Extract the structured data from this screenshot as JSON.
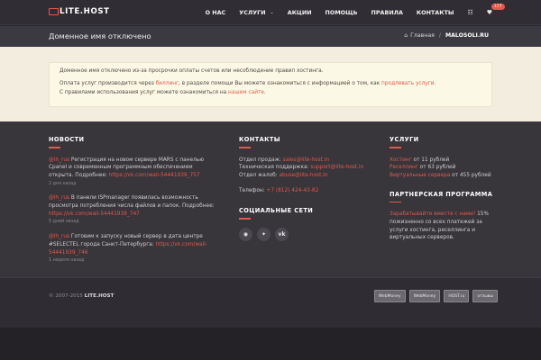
{
  "header": {
    "logo_text": "LITE.HOST",
    "nav": [
      {
        "label": "О НАС"
      },
      {
        "label": "УСЛУГИ",
        "has_dropdown": true
      },
      {
        "label": "АКЦИИ"
      },
      {
        "label": "ПОМОЩЬ"
      },
      {
        "label": "ПРАВИЛА"
      },
      {
        "label": "КОНТАКТЫ"
      }
    ],
    "cart_badge": "177",
    "icons": [
      "list-icon",
      "heart-icon"
    ]
  },
  "titlebar": {
    "title": "Доменное имя отключено",
    "breadcrumb_home": "Главная",
    "breadcrumb_sep": "/",
    "breadcrumb_current": "MALOSOLI.RU"
  },
  "notice": {
    "line1": "Доменное имя отключено из-за просрочки оплаты счетов или несоблюдение правил хостинга.",
    "line2_pre": "Оплата услуг производится через ",
    "line2_link1": "биллинг",
    "line2_mid": ", в разделе помощи Вы можете ознакомиться с информацией о том, как ",
    "line2_link2": "продлевать услуги",
    "line2_post": ".",
    "line3_pre": "С правилами использования услуг можете ознакомиться на ",
    "line3_link": "нашем сайте",
    "line3_post": "."
  },
  "footer": {
    "news_title": "НОВОСТИ",
    "news": [
      {
        "user": "@lh_rus",
        "text": " Регистрация на новом сервере MARS с панелью Cpanel и современным программным обеспечением открыта. Подробнее: ",
        "link": "https://vk.com/wall-54441939_757",
        "date": "2 дня назад"
      },
      {
        "user": "@lh_rus",
        "text": " В панели ISPmanager появилась возможность просмотра потребления числа файлов и папок. Подробнее: ",
        "link": "https://vk.com/wall-54441939_747",
        "date": "5 дней назад"
      },
      {
        "user": "@lh_rus",
        "text": " Готовим к запуску новый сервер в дата центре #SELECTEL города Санкт-Петербурга: ",
        "link": "https://vk.com/wall-54441939_746",
        "date": "1 неделя назад"
      }
    ],
    "contacts_title": "КОНТАКТЫ",
    "contacts": [
      {
        "label": "Отдел продаж: ",
        "value": "sales@lite-host.in"
      },
      {
        "label": "Техническая поддержка: ",
        "value": "support@lite-host.in"
      },
      {
        "label": "Отдел жалоб: ",
        "value": "abuse@lite-host.in"
      }
    ],
    "phone_label": "Телефон: ",
    "phone": "+7 (812) 424-43-82",
    "social_title": "СОЦИАЛЬНЫЕ СЕТИ",
    "social": [
      {
        "icon": "rss-icon",
        "glyph": "◉"
      },
      {
        "icon": "twitter-icon",
        "glyph": "✦"
      },
      {
        "icon": "vk-icon",
        "glyph": "vk"
      }
    ],
    "services_title": "УСЛУГИ",
    "services": [
      {
        "name": "Хостинг",
        "price": " от 11 рублей"
      },
      {
        "name": "Реселлинг",
        "price": " от 63 рублей"
      },
      {
        "name": "Виртуальные сервера",
        "price": " от 455 рублей"
      }
    ],
    "partner_title": "ПАРТНЕРСКАЯ ПРОГРАММА",
    "partner_link": "Зарабатывайте вместе с нами!",
    "partner_text": " 15% пожизненно со всех платежей за услуги хостинга, реселлинга и виртуальных серверов.",
    "copyright": "© 2007-2015",
    "copyright_brand": "LITE.HOST",
    "badges": [
      "WebMoney",
      "WebMoney",
      "HOST.ru",
      "отзывы"
    ]
  },
  "colors": {
    "accent": "#e05a4e",
    "header_bg": "#302e34",
    "content_bg": "#f3ede0",
    "footer_bg": "#38353b"
  }
}
